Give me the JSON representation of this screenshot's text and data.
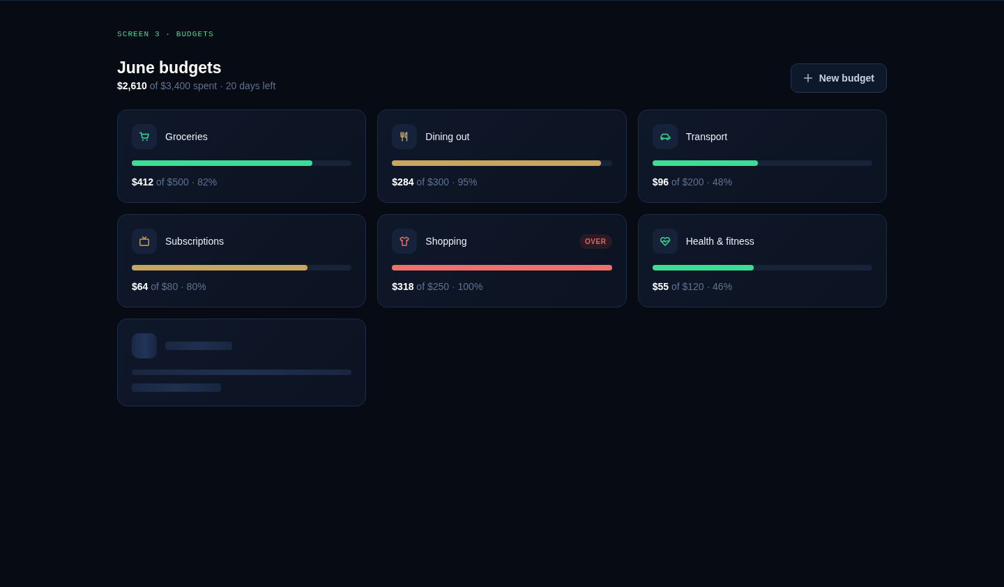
{
  "eyebrow": "SCREEN 3 · BUDGETS",
  "header": {
    "title": "June budgets",
    "subtitle": "**$2,610** of $3,400 spent · 20 days left",
    "button": {
      "label": "New budget"
    }
  },
  "cards": [
    {
      "kind": "budget",
      "name": "Groceries",
      "level": 0.82,
      "color": "#3ddc97",
      "amount": "**$412** of $500 · 82%"
    },
    {
      "kind": "budget",
      "name": "Dining out",
      "level": 0.95,
      "color": "#c9a55f",
      "amount": "**$284** of $300 · 95%"
    },
    {
      "kind": "budget",
      "name": "Transport",
      "level": 0.48,
      "color": "#3ddc97",
      "amount": "**$96** of $200 · 48%"
    },
    {
      "kind": "budget",
      "name": "Subscriptions",
      "level": 0.8,
      "color": "#c9a55f",
      "amount": "**$64** of $80 · 80%"
    },
    {
      "kind": "budget",
      "name": "Shopping",
      "badge": "OVER",
      "level": 1,
      "color": "#ef716b",
      "amount": "**$318** of $250 · 100%"
    },
    {
      "kind": "budget",
      "name": "Health & fitness",
      "level": 0.46,
      "color": "#3ddc97",
      "amount": "**$55** of $120 · 46%"
    },
    {
      "kind": "skeleton"
    }
  ]
}
